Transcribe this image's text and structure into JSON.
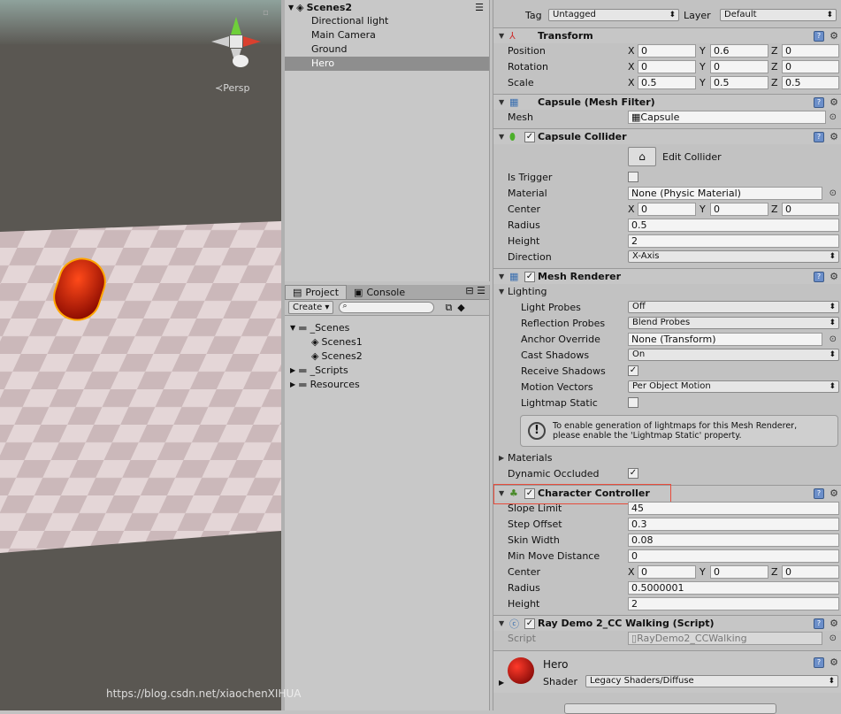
{
  "scene": {
    "persp_label": "Persp"
  },
  "hierarchy": {
    "scene_name": "Scenes2",
    "items": [
      "Directional light",
      "Main Camera",
      "Ground",
      "Hero"
    ]
  },
  "project": {
    "tabs": [
      "Project",
      "Console"
    ],
    "create_label": "Create",
    "tree": [
      "_Scenes",
      "Scenes1",
      "Scenes2",
      "_Scripts",
      "Resources"
    ]
  },
  "inspector": {
    "tag_label": "Tag",
    "tag_value": "Untagged",
    "layer_label": "Layer",
    "layer_value": "Default",
    "transform": {
      "title": "Transform",
      "position_label": "Position",
      "position": [
        "0",
        "0.6",
        "0"
      ],
      "rotation_label": "Rotation",
      "rotation": [
        "0",
        "0",
        "0"
      ],
      "scale_label": "Scale",
      "scale": [
        "0.5",
        "0.5",
        "0.5"
      ]
    },
    "mesh_filter": {
      "title": "Capsule (Mesh Filter)",
      "mesh_label": "Mesh",
      "mesh_value": "Capsule"
    },
    "capsule_collider": {
      "title": "Capsule Collider",
      "edit_label": "Edit Collider",
      "is_trigger_label": "Is Trigger",
      "material_label": "Material",
      "material_value": "None (Physic Material)",
      "center_label": "Center",
      "center": [
        "0",
        "0",
        "0"
      ],
      "radius_label": "Radius",
      "radius": "0.5",
      "height_label": "Height",
      "height": "2",
      "direction_label": "Direction",
      "direction": "X-Axis"
    },
    "mesh_renderer": {
      "title": "Mesh Renderer",
      "lighting_label": "Lighting",
      "light_probes_label": "Light Probes",
      "light_probes": "Off",
      "reflection_label": "Reflection Probes",
      "reflection": "Blend Probes",
      "anchor_label": "Anchor Override",
      "anchor": "None (Transform)",
      "cast_label": "Cast Shadows",
      "cast": "On",
      "receive_label": "Receive Shadows",
      "motion_label": "Motion Vectors",
      "motion": "Per Object Motion",
      "lightmap_label": "Lightmap Static",
      "note_line1": "To enable generation of lightmaps for this Mesh Renderer,",
      "note_line2": "please enable the 'Lightmap Static' property.",
      "materials_label": "Materials",
      "dynamic_label": "Dynamic Occluded"
    },
    "character_controller": {
      "title": "Character Controller",
      "slope_label": "Slope Limit",
      "slope": "45",
      "step_label": "Step Offset",
      "step": "0.3",
      "skin_label": "Skin Width",
      "skin": "0.08",
      "minmove_label": "Min Move Distance",
      "minmove": "0",
      "center_label": "Center",
      "center": [
        "0",
        "0",
        "0"
      ],
      "radius_label": "Radius",
      "radius": "0.5000001",
      "height_label": "Height",
      "height": "2"
    },
    "script": {
      "title": "Ray Demo 2_CC Walking (Script)",
      "script_label": "Script",
      "script_value": "RayDemo2_CCWalking"
    },
    "material": {
      "name": "Hero",
      "shader_label": "Shader",
      "shader_value": "Legacy Shaders/Diffuse"
    }
  },
  "watermark": "https://blog.csdn.net/xiaochenXIHUA",
  "colors": {
    "highlight": "#e74c3c",
    "selection": "#8e8e8e",
    "hero": "#d81c00"
  }
}
